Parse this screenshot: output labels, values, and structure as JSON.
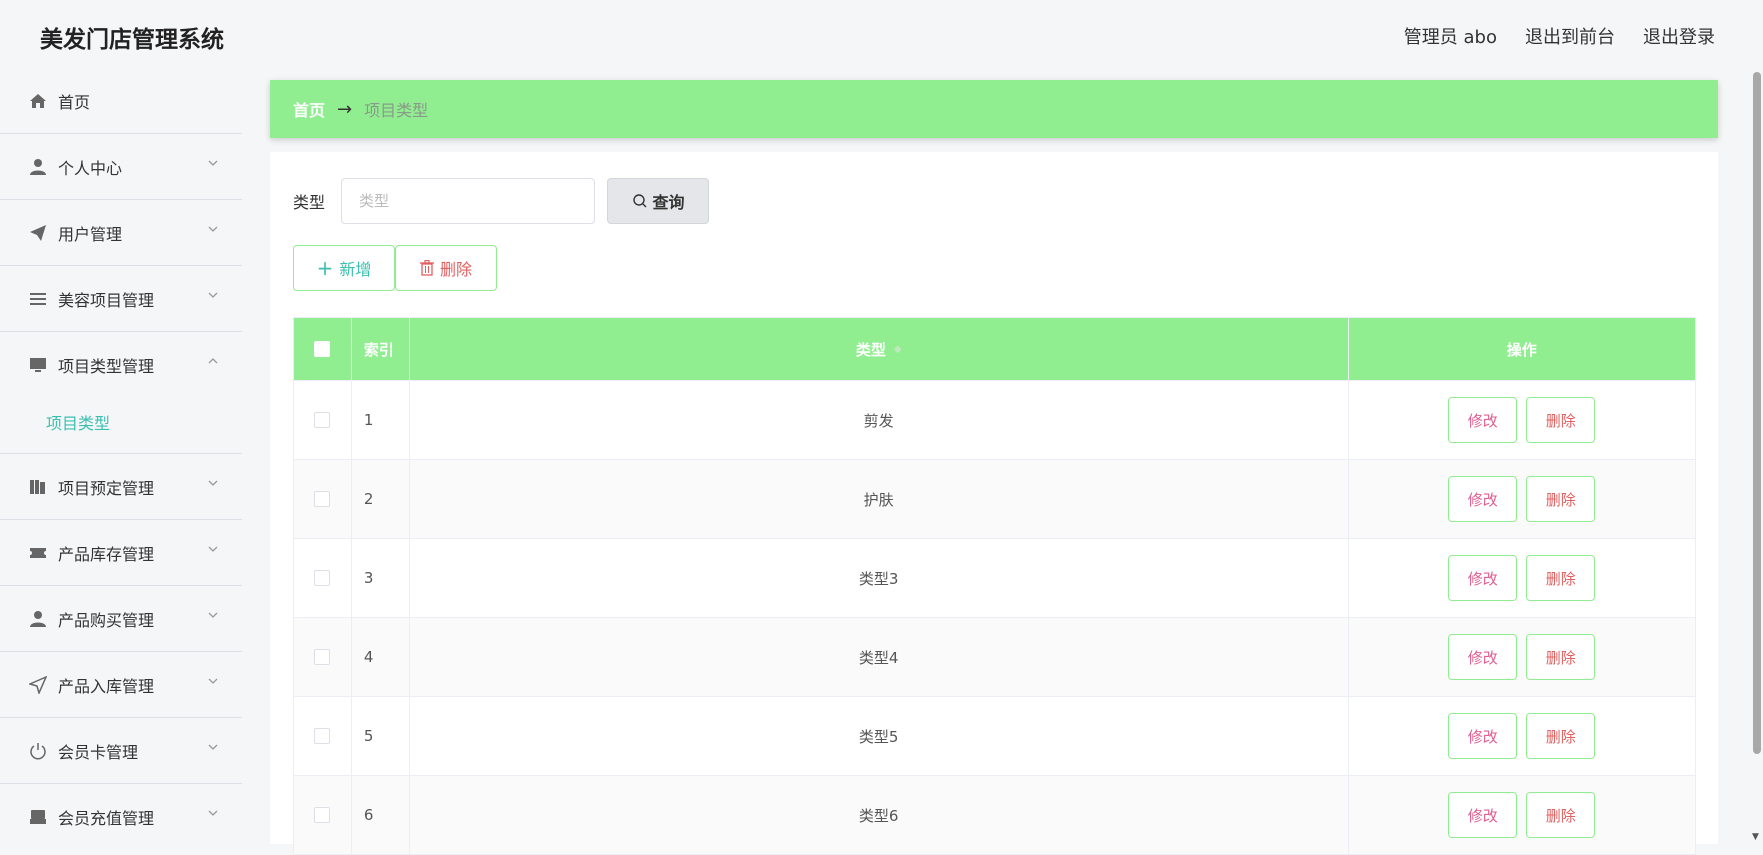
{
  "header": {
    "title": "美发门店管理系统",
    "user_label": "管理员 abo",
    "exit_front": "退出到前台",
    "logout": "退出登录"
  },
  "sidebar": {
    "items": [
      {
        "label": "首页",
        "icon": "home-icon"
      },
      {
        "label": "个人中心",
        "icon": "user-icon"
      },
      {
        "label": "用户管理",
        "icon": "send-icon"
      },
      {
        "label": "美容项目管理",
        "icon": "list-icon"
      },
      {
        "label": "项目类型管理",
        "icon": "monitor-icon",
        "expanded": true
      },
      {
        "label": "项目预定管理",
        "icon": "books-icon"
      },
      {
        "label": "产品库存管理",
        "icon": "ticket-icon"
      },
      {
        "label": "产品购买管理",
        "icon": "user-icon"
      },
      {
        "label": "产品入库管理",
        "icon": "navigation-icon"
      },
      {
        "label": "会员卡管理",
        "icon": "power-icon"
      },
      {
        "label": "会员充值管理",
        "icon": "printer-icon"
      }
    ],
    "submenu_active": "项目类型"
  },
  "breadcrumb": {
    "home": "首页",
    "arrow": "→",
    "current": "项目类型"
  },
  "search": {
    "label": "类型",
    "placeholder": "类型",
    "value": "",
    "query_button": "查询"
  },
  "actions": {
    "add_button": "新增",
    "delete_button": "删除"
  },
  "table": {
    "columns": [
      "索引",
      "类型",
      "操作"
    ],
    "rows": [
      {
        "index": "1",
        "type": "剪发"
      },
      {
        "index": "2",
        "type": "护肤"
      },
      {
        "index": "3",
        "type": "类型3"
      },
      {
        "index": "4",
        "type": "类型4"
      },
      {
        "index": "5",
        "type": "类型5"
      },
      {
        "index": "6",
        "type": "类型6"
      }
    ],
    "edit_label": "修改",
    "remove_label": "删除"
  },
  "colors": {
    "accent_green": "#90ee90",
    "teal": "#3bbfb0",
    "danger": "#e06060",
    "edit_pink": "#e06090"
  }
}
